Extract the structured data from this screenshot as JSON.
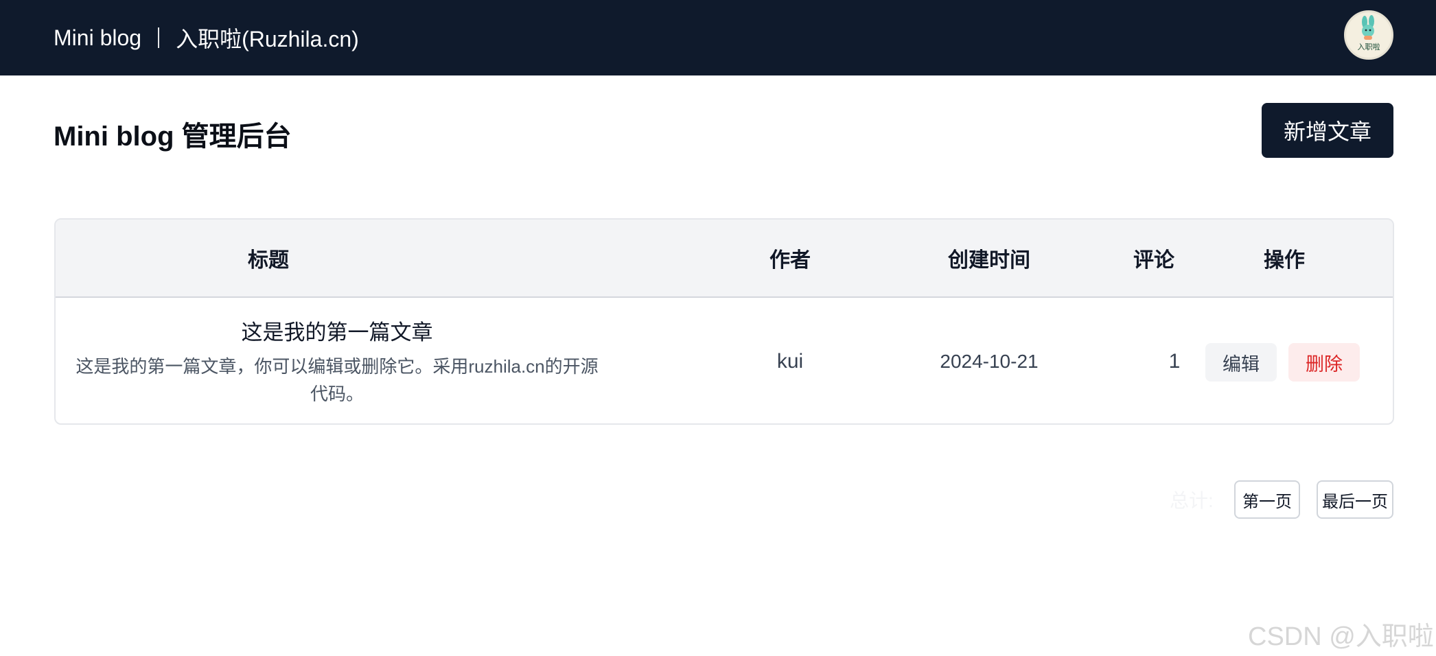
{
  "header": {
    "app_name": "Mini blog",
    "site_name": "入职啦(Ruzhila.cn)",
    "avatar_label": "入职啦"
  },
  "main": {
    "page_title": "Mini blog 管理后台",
    "add_button_label": "新增文章"
  },
  "table": {
    "columns": [
      "标题",
      "作者",
      "创建时间",
      "评论",
      "操作"
    ],
    "rows": [
      {
        "title": "这是我的第一篇文章",
        "summary": "这是我的第一篇文章，你可以编辑或删除它。采用ruzhila.cn的开源代码。",
        "author": "kui",
        "created_at": "2024-10-21",
        "comments": "1",
        "edit_label": "编辑",
        "delete_label": "删除"
      }
    ]
  },
  "pagination": {
    "total_label": "总计:",
    "first_page_label": "第一页",
    "last_page_label": "最后一页"
  },
  "watermark": "CSDN @入职啦",
  "colors": {
    "header_bg": "#0f1a2c",
    "delete_text": "#dc2626",
    "delete_bg": "#fdecec"
  },
  "icons": {
    "avatar": "rabbit-mascot-icon"
  }
}
